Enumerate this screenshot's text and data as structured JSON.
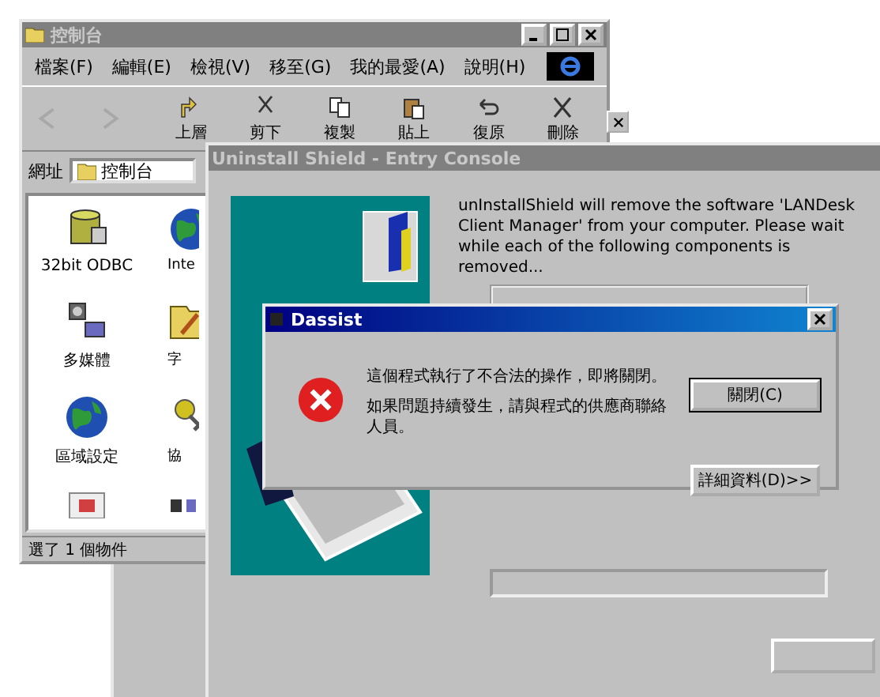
{
  "explorer": {
    "title": "控制台",
    "menu": [
      "檔案(F)",
      "編輯(E)",
      "檢視(V)",
      "移至(G)",
      "我的最愛(A)",
      "說明(H)"
    ],
    "toolbar": [
      "上層",
      "剪下",
      "複製",
      "貼上",
      "復原",
      "刪除"
    ],
    "address_label": "網址",
    "address": "控制台",
    "items": [
      "32bit ODBC",
      "Inte",
      "多媒體",
      "字",
      "區域設定",
      "協"
    ],
    "status": "選了 1 個物件"
  },
  "installer": {
    "title": "Uninstall Shield - Entry Console",
    "message": "unInstallShield will remove the software 'LANDesk Client Manager' from your computer. Please wait while each of the following components is removed...",
    "progress": {
      "level": 0
    }
  },
  "error_dialog": {
    "title": "Dassist",
    "lines": [
      "這個程式執行了不合法的操作，即將關閉。",
      "如果問題持續發生，請與程式的供應商聯絡人員。"
    ],
    "buttons": [
      "關閉(C)",
      "詳細資料(D)>>"
    ]
  }
}
